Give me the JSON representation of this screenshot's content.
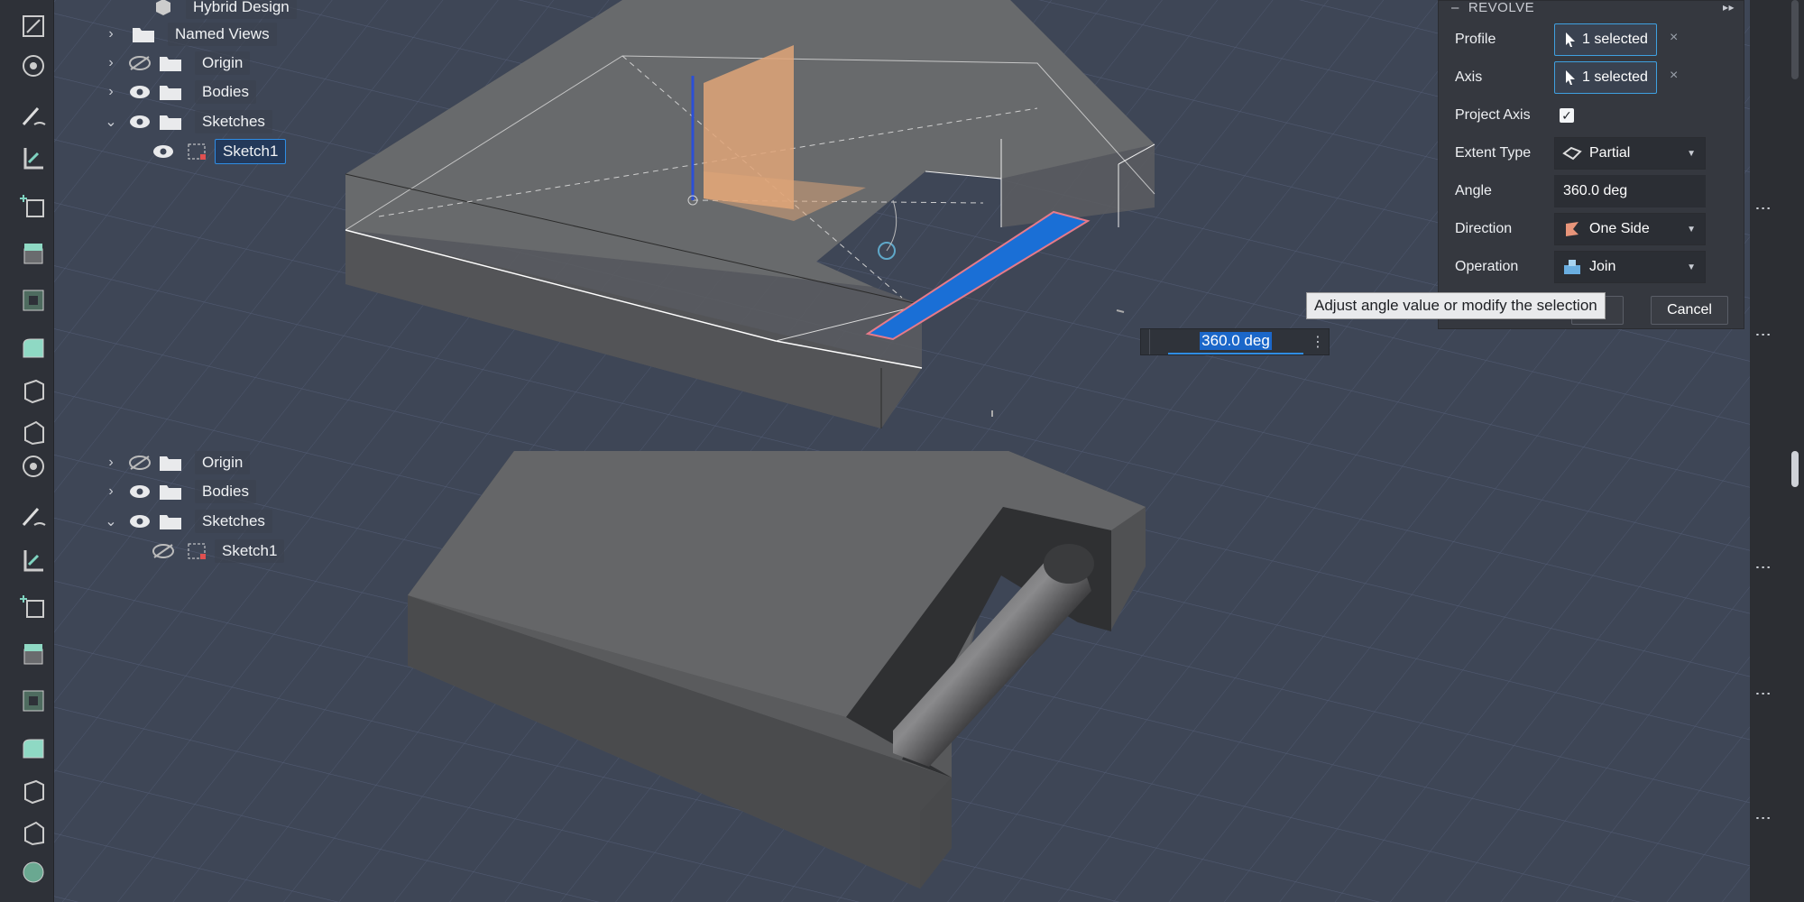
{
  "browser_top": {
    "partial_item": "Hybrid Design",
    "items": [
      {
        "label": "Named Views",
        "expanded": false,
        "visible": null
      },
      {
        "label": "Origin",
        "expanded": false,
        "visible": false
      },
      {
        "label": "Bodies",
        "expanded": false,
        "visible": true
      },
      {
        "label": "Sketches",
        "expanded": true,
        "visible": true
      },
      {
        "label": "Sketch1",
        "child": true,
        "visible": true,
        "selected": true
      }
    ]
  },
  "browser_bottom": {
    "items": [
      {
        "label": "Origin",
        "expanded": false,
        "visible": false
      },
      {
        "label": "Bodies",
        "expanded": false,
        "visible": true
      },
      {
        "label": "Sketches",
        "expanded": true,
        "visible": true
      },
      {
        "label": "Sketch1",
        "child": true,
        "visible": false
      }
    ]
  },
  "revolve": {
    "title": "REVOLVE",
    "profile_label": "Profile",
    "profile_value": "1 selected",
    "axis_label": "Axis",
    "axis_value": "1 selected",
    "project_axis_label": "Project Axis",
    "project_axis_checked": true,
    "extent_type_label": "Extent Type",
    "extent_type_value": "Partial",
    "angle_label": "Angle",
    "angle_value": "360.0 deg",
    "direction_label": "Direction",
    "direction_value": "One Side",
    "operation_label": "Operation",
    "operation_value": "Join",
    "cancel_label": "Cancel",
    "tooltip": "Adjust angle value or modify the selection"
  },
  "angle_input": {
    "value": "360.0 deg"
  },
  "colors": {
    "background": "#3e4656",
    "body": "#5e5f61",
    "selection_blue": "#1a6fd6",
    "plane_orange": "#e0a578",
    "accent": "#2f8de4"
  }
}
